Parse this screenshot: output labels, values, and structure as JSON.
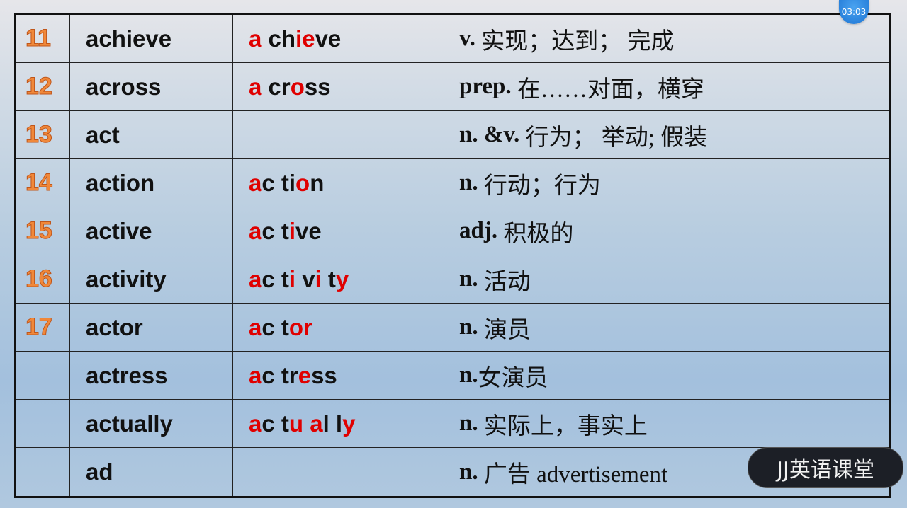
{
  "overlay": {
    "timer": "03:03",
    "watermark": "JJ英语课堂"
  },
  "colors": {
    "number": "#f0883a",
    "highlight": "#e00000",
    "text": "#111111"
  },
  "rows": [
    {
      "num": "11",
      "word": "achieve",
      "syllables": [
        {
          "t": "a",
          "hl": true
        },
        {
          "t": " ch",
          "hl": false
        },
        {
          "t": "ie",
          "hl": true
        },
        {
          "t": "ve",
          "hl": false
        }
      ],
      "pos": "v.",
      "meaning": " 实现；达到； 完成"
    },
    {
      "num": "12",
      "word": "across",
      "syllables": [
        {
          "t": "a",
          "hl": true
        },
        {
          "t": " cr",
          "hl": false
        },
        {
          "t": "o",
          "hl": true
        },
        {
          "t": "ss",
          "hl": false
        }
      ],
      "pos": "prep.",
      "meaning": " 在……对面，横穿"
    },
    {
      "num": "13",
      "word": "act",
      "syllables": [],
      "pos": "n. &v.",
      "meaning": " 行为； 举动; 假装"
    },
    {
      "num": "14",
      "word": "action",
      "syllables": [
        {
          "t": "a",
          "hl": true
        },
        {
          "t": "c ti",
          "hl": false
        },
        {
          "t": "o",
          "hl": true
        },
        {
          "t": "n",
          "hl": false
        }
      ],
      "pos": "n.",
      "meaning": " 行动；行为"
    },
    {
      "num": "15",
      "word": "active",
      "syllables": [
        {
          "t": "a",
          "hl": true
        },
        {
          "t": "c t",
          "hl": false
        },
        {
          "t": "i",
          "hl": true
        },
        {
          "t": "ve",
          "hl": false
        }
      ],
      "pos": "adj.",
      "meaning": " 积极的"
    },
    {
      "num": "16",
      "word": "activity",
      "syllables": [
        {
          "t": "a",
          "hl": true
        },
        {
          "t": "c t",
          "hl": false
        },
        {
          "t": "i",
          "hl": true
        },
        {
          "t": " v",
          "hl": false
        },
        {
          "t": "i",
          "hl": true
        },
        {
          "t": " t",
          "hl": false
        },
        {
          "t": "y",
          "hl": true
        }
      ],
      "pos": "n.",
      "meaning": " 活动"
    },
    {
      "num": "17",
      "word": "actor",
      "syllables": [
        {
          "t": "a",
          "hl": true
        },
        {
          "t": "c t",
          "hl": false
        },
        {
          "t": "or",
          "hl": true
        }
      ],
      "pos": "n.",
      "meaning": " 演员"
    },
    {
      "num": "",
      "word": "actress",
      "syllables": [
        {
          "t": "a",
          "hl": true
        },
        {
          "t": "c tr",
          "hl": false
        },
        {
          "t": "e",
          "hl": true
        },
        {
          "t": "ss",
          "hl": false
        }
      ],
      "pos": "n.",
      "meaning": "女演员"
    },
    {
      "num": "",
      "word": "actually",
      "syllables": [
        {
          "t": "a",
          "hl": true
        },
        {
          "t": "c t",
          "hl": false
        },
        {
          "t": "u",
          "hl": true
        },
        {
          "t": " ",
          "hl": false
        },
        {
          "t": "a",
          "hl": true
        },
        {
          "t": "l l",
          "hl": false
        },
        {
          "t": "y",
          "hl": true
        }
      ],
      "pos": "n.",
      "meaning": " 实际上，事实上"
    },
    {
      "num": "",
      "word": "ad",
      "syllables": [],
      "pos": "n.",
      "meaning": " 广告 advertisement"
    }
  ]
}
